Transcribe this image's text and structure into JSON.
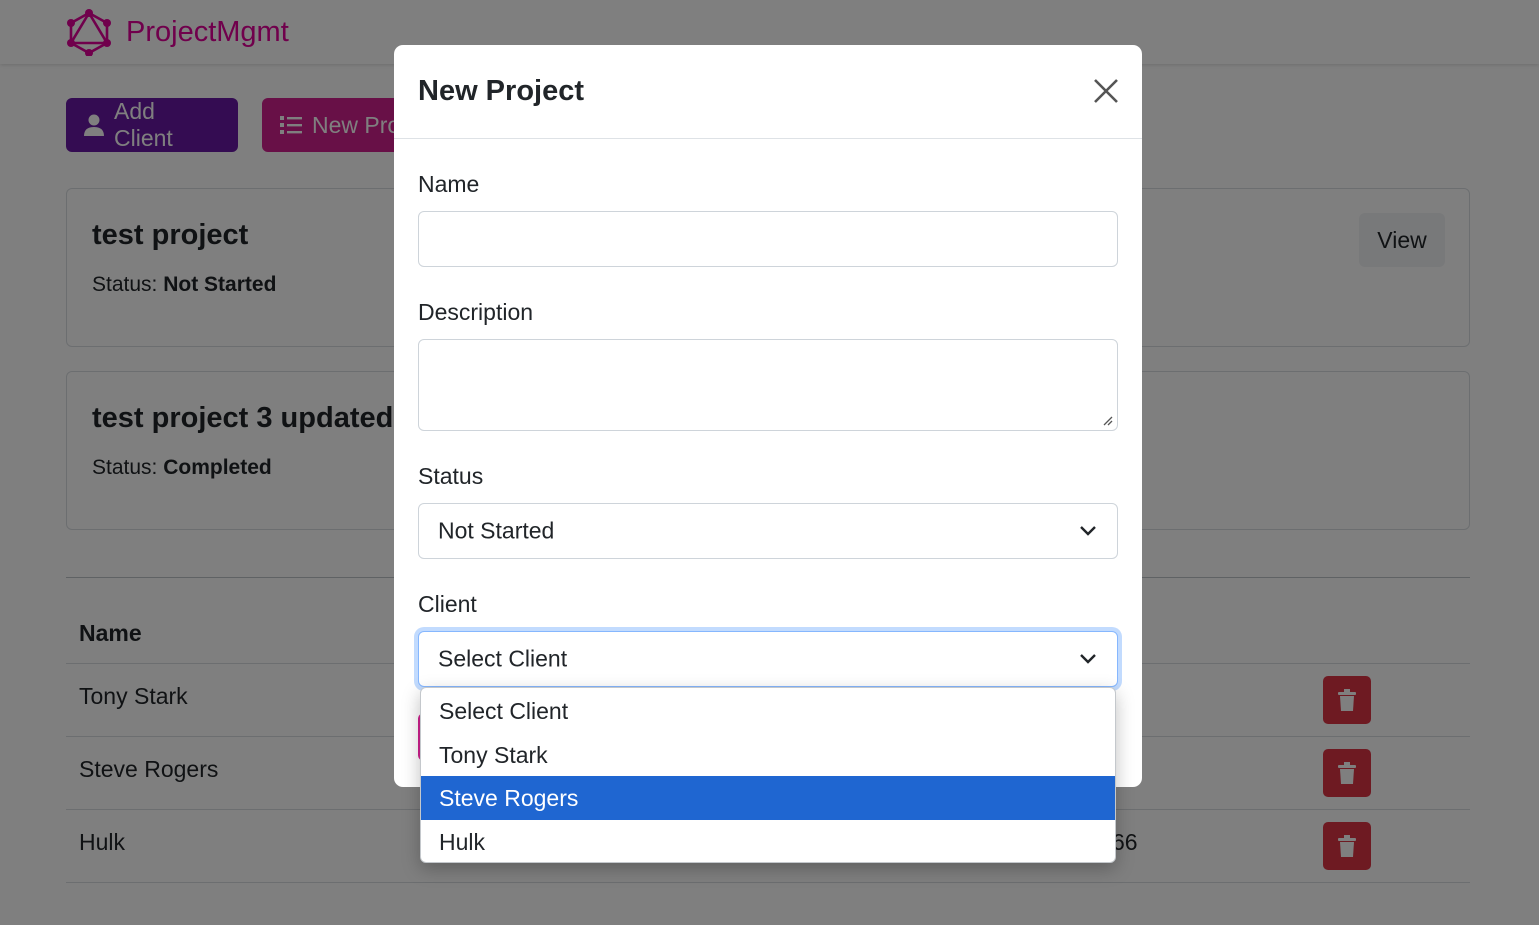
{
  "brand": {
    "name": "ProjectMgmt",
    "color": "#e10098"
  },
  "toolbar": {
    "add_client_label": "Add Client",
    "new_project_label": "New Project"
  },
  "projects": [
    {
      "name": "test project",
      "status_label": "Status:",
      "status": "Not Started",
      "view_label": "View"
    },
    {
      "name": "test project 3 updated",
      "status_label": "Status:",
      "status": "Completed"
    }
  ],
  "clients_table": {
    "header_name": "Name",
    "rows": [
      {
        "name": "Tony Stark"
      },
      {
        "name": "Steve Rogers"
      },
      {
        "name": "Hulk",
        "partial_value": "66"
      }
    ]
  },
  "modal": {
    "title": "New Project",
    "name_label": "Name",
    "name_value": "",
    "description_label": "Description",
    "description_value": "",
    "status_label": "Status",
    "status_value": "Not Started",
    "client_label": "Client",
    "client_value": "Select Client",
    "client_options": [
      "Select Client",
      "Tony Stark",
      "Steve Rogers",
      "Hulk"
    ],
    "client_highlighted": "Steve Rogers"
  },
  "colors": {
    "purple": "#6818a5",
    "pink": "#d1208f",
    "danger": "#dc3545",
    "highlight": "#1f66d1"
  }
}
